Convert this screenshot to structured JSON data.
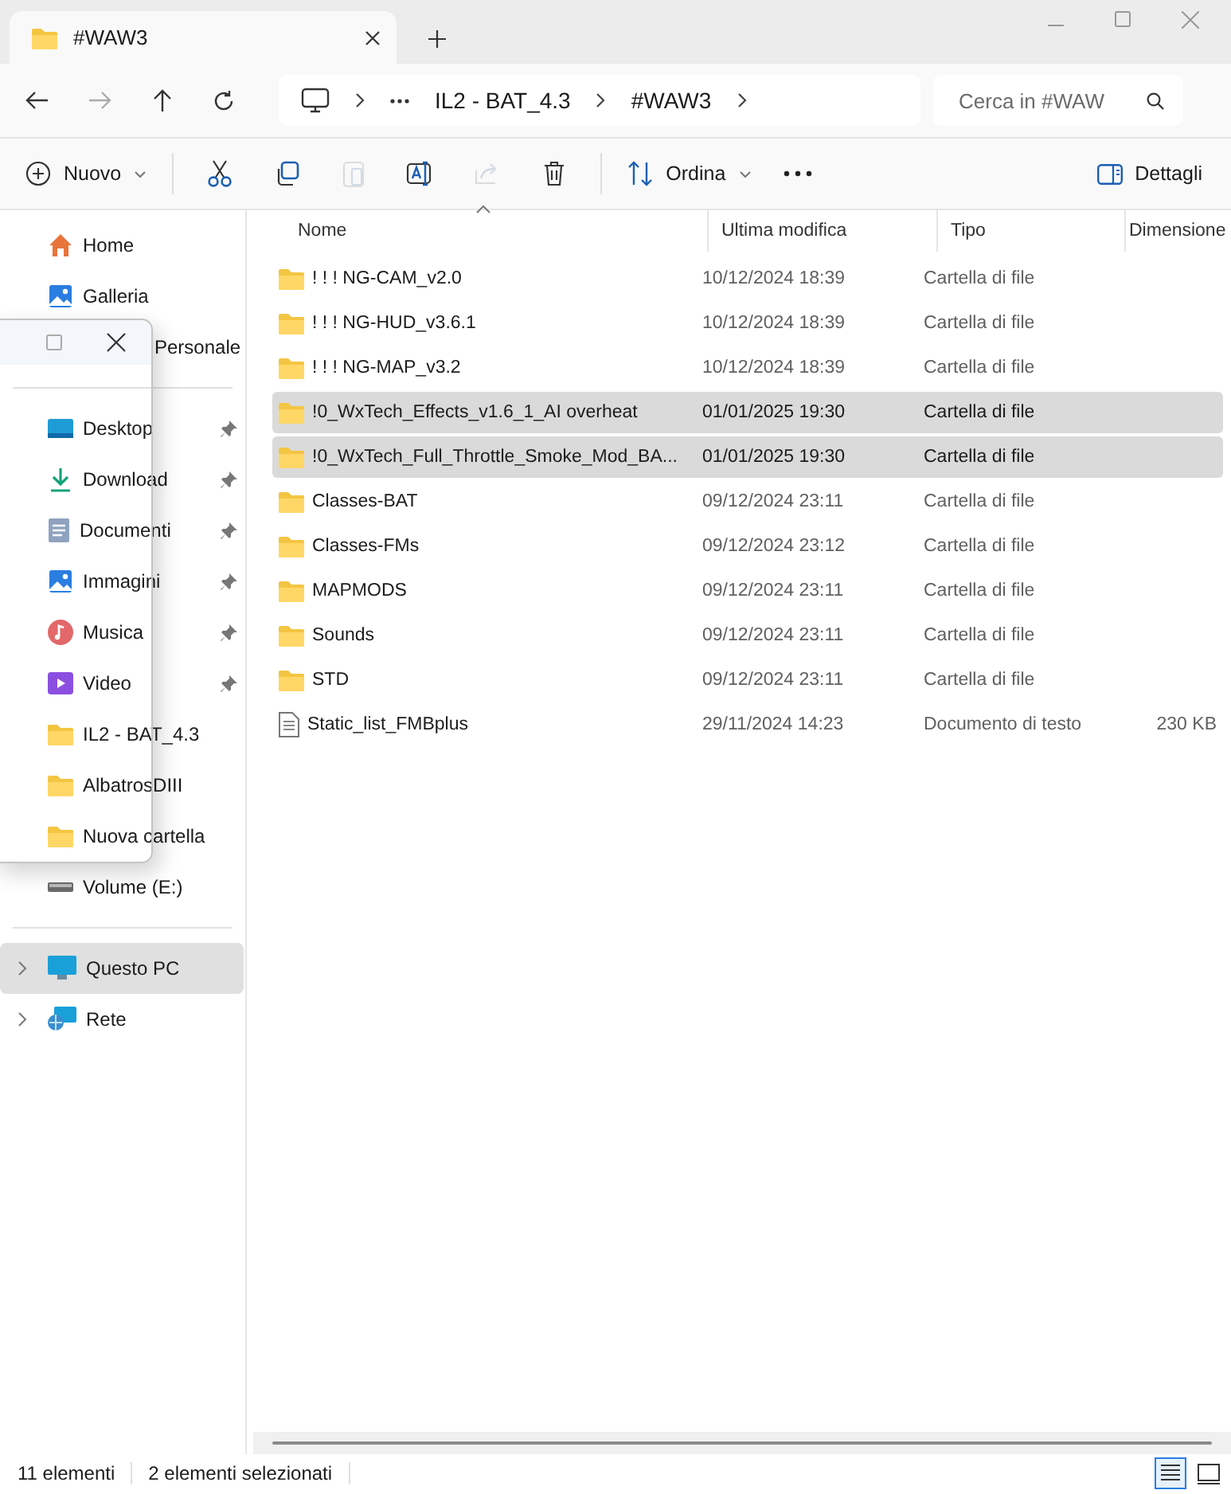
{
  "tab": {
    "title": "#WAW3"
  },
  "address": {
    "segments": [
      "IL2 - BAT_4.3",
      "#WAW3"
    ]
  },
  "search": {
    "placeholder": "Cerca in #WAW"
  },
  "toolbar": [
    {
      "kind": "new",
      "label": "Nuovo",
      "disabled": false
    },
    {
      "kind": "cut",
      "disabled": false
    },
    {
      "kind": "copy",
      "disabled": false
    },
    {
      "kind": "paste",
      "disabled": true
    },
    {
      "kind": "rename",
      "disabled": false
    },
    {
      "kind": "share",
      "disabled": true
    },
    {
      "kind": "delete",
      "disabled": false
    },
    {
      "kind": "sort",
      "label": "Ordina",
      "disabled": false
    },
    {
      "kind": "more",
      "disabled": false
    }
  ],
  "details_button": {
    "label": "Dettagli"
  },
  "sidebar": {
    "sections": [
      [
        {
          "kind": "home",
          "label": "Home",
          "selected": false
        },
        {
          "kind": "gallery",
          "label": "Galleria",
          "selected": false
        },
        {
          "kind": "cloud",
          "label": "Personale",
          "selected": false
        }
      ],
      [
        {
          "kind": "desktop",
          "label": "Desktop",
          "pinned": true,
          "selected": false
        },
        {
          "kind": "download",
          "label": "Download",
          "pinned": true,
          "selected": false
        },
        {
          "kind": "documents",
          "label": "Documenti",
          "pinned": true,
          "selected": false
        },
        {
          "kind": "pictures",
          "label": "Immagini",
          "pinned": true,
          "selected": false
        },
        {
          "kind": "music",
          "label": "Musica",
          "pinned": true,
          "selected": false
        },
        {
          "kind": "video",
          "label": "Video",
          "pinned": true,
          "selected": false
        },
        {
          "kind": "folder",
          "label": "IL2 - BAT_4.3",
          "pinned": false,
          "selected": false
        },
        {
          "kind": "folder",
          "label": "AlbatrosDIII",
          "pinned": false,
          "selected": false
        },
        {
          "kind": "folder",
          "label": "Nuova cartella",
          "pinned": false,
          "selected": false
        },
        {
          "kind": "drive",
          "label": "Volume (E:)",
          "pinned": false,
          "selected": false
        }
      ],
      [
        {
          "kind": "pc",
          "label": "Questo PC",
          "selected": true,
          "expanded": false
        },
        {
          "kind": "network",
          "label": "Rete",
          "selected": false,
          "expanded": false
        }
      ]
    ]
  },
  "table": {
    "columns": [
      "Nome",
      "Ultima modifica",
      "Tipo",
      "Dimensione"
    ],
    "rows": [
      {
        "kind": "folder",
        "name": "! ! ! NG-CAM_v2.0",
        "modified": "10/12/2024 18:39",
        "type": "Cartella di file",
        "selected": false
      },
      {
        "kind": "folder",
        "name": "! ! ! NG-HUD_v3.6.1",
        "modified": "10/12/2024 18:39",
        "type": "Cartella di file",
        "selected": false
      },
      {
        "kind": "folder",
        "name": "! ! ! NG-MAP_v3.2",
        "modified": "10/12/2024 18:39",
        "type": "Cartella di file",
        "selected": false
      },
      {
        "kind": "folder",
        "name": "!0_WxTech_Effects_v1.6_1_AI overheat",
        "modified": "01/01/2025 19:30",
        "type": "Cartella di file",
        "selected": true
      },
      {
        "kind": "folder",
        "name": "!0_WxTech_Full_Throttle_Smoke_Mod_BA...",
        "modified": "01/01/2025 19:30",
        "type": "Cartella di file",
        "selected": true
      },
      {
        "kind": "folder",
        "name": "Classes-BAT",
        "modified": "09/12/2024 23:11",
        "type": "Cartella di file",
        "selected": false
      },
      {
        "kind": "folder",
        "name": "Classes-FMs",
        "modified": "09/12/2024 23:12",
        "type": "Cartella di file",
        "selected": false
      },
      {
        "kind": "folder",
        "name": "MAPMODS",
        "modified": "09/12/2024 23:11",
        "type": "Cartella di file",
        "selected": false
      },
      {
        "kind": "folder",
        "name": "Sounds",
        "modified": "09/12/2024 23:11",
        "type": "Cartella di file",
        "selected": false
      },
      {
        "kind": "folder",
        "name": "STD",
        "modified": "09/12/2024 23:11",
        "type": "Cartella di file",
        "selected": false
      },
      {
        "kind": "text",
        "name": "Static_list_FMBplus",
        "modified": "29/11/2024 14:23",
        "type": "Documento di testo",
        "size": "230 KB",
        "selected": false
      }
    ]
  },
  "status_bar": {
    "count": "11 elementi",
    "selection": "2 elementi selezionati",
    "views": [
      {
        "kind": "details",
        "selected": true
      },
      {
        "kind": "tiles",
        "selected": false
      }
    ]
  }
}
